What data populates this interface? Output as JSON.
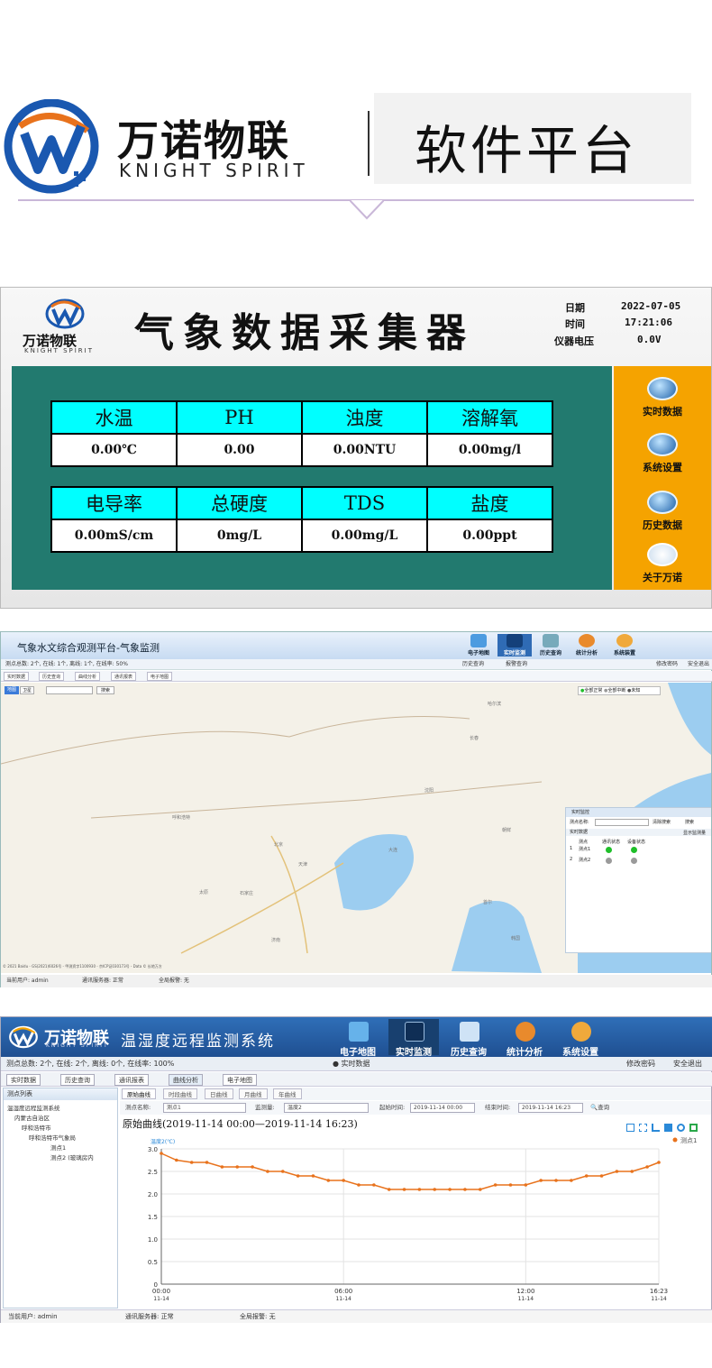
{
  "banner": {
    "brand_cn": "万诺物联",
    "brand_en": "KNIGHT SPIRIT",
    "title": "软件平台",
    "logo_icon": "wn-logo-icon"
  },
  "panel1": {
    "logo_cn": "万诺物联",
    "logo_en": "KNIGHT SPIRIT",
    "title": "气象数据采集器",
    "date_label": "日期",
    "date_value": "2022-07-05",
    "time_label": "时间",
    "time_value": "17:21:06",
    "voltage_label": "仪器电压",
    "voltage_value": "0.0V",
    "row1_headers": [
      "水温",
      "PH",
      "浊度",
      "溶解氧"
    ],
    "row1_values": [
      "0.00℃",
      "0.00",
      "0.00NTU",
      "0.00mg/l"
    ],
    "row2_headers": [
      "电导率",
      "总硬度",
      "TDS",
      "盐度"
    ],
    "row2_values": [
      "0.00mS/cm",
      "0mg/L",
      "0.00mg/L",
      "0.00ppt"
    ],
    "side_buttons": [
      {
        "label": "实时数据",
        "icon": "search-icon"
      },
      {
        "label": "系统设置",
        "icon": "settings-icon"
      },
      {
        "label": "历史数据",
        "icon": "save-icon"
      },
      {
        "label": "关于万诺",
        "icon": "wn-logo-icon"
      }
    ],
    "colors": {
      "teal": "#227a6f",
      "cyan": "#00ffff",
      "orange": "#f5a300"
    }
  },
  "panel2": {
    "title": "气象水文综合观测平台-气象监测",
    "toolbar": [
      "电子地图",
      "实时监测",
      "历史查询",
      "统计分析",
      "系统装置"
    ],
    "links": [
      "历史查询",
      "报警查询"
    ],
    "right_links": [
      "修改密码",
      "安全退出"
    ],
    "summary": "测点总数: 2个, 在线: 1个, 离线: 1个, 在线率: 50%",
    "tabs": [
      "实时数据",
      "历史查询",
      "曲线分析",
      "通讯报表",
      "电子地图"
    ],
    "map_types": [
      "地图",
      "卫星"
    ],
    "search_btn": "搜索",
    "legend": [
      "全部正常",
      "全部中断",
      "未知"
    ],
    "map_labels": [
      "北京",
      "天津",
      "沈阳",
      "大连",
      "朝鲜",
      "韩国",
      "首尔",
      "呼和浩特",
      "太原",
      "石家庄",
      "济南",
      "长春",
      "哈尔滨"
    ],
    "map_copyright": "© 2021 Baidu - GS(2021)6026号 - 甲测资字1100930 - 京ICP证030173号 - Data © 长地万方",
    "panel_title": "实时监控",
    "panel_search_label": "测点名称:",
    "panel_btns": [
      "清除搜索",
      "搜索"
    ],
    "panel_sub": "实时数据",
    "panel_show": "显示监测量",
    "panel_cols": [
      "测点",
      "通讯状态",
      "设备状态"
    ],
    "panel_rows": [
      {
        "idx": "1",
        "name": "测点1",
        "comm": "#1fbf2a",
        "dev": "#1fbf2a"
      },
      {
        "idx": "2",
        "name": "测点2",
        "comm": "#9a9a9a",
        "dev": "#9a9a9a"
      }
    ],
    "status_user": "当前用户: admin",
    "status_server": "通讯服务器: 正常",
    "status_alarm": "全局报警: 无"
  },
  "panel3": {
    "brand_cn": "万诺物联",
    "brand_en": "KNIGHT SPIRIT",
    "system_title": "温湿度远程监测系统",
    "toolbar": [
      "电子地图",
      "实时监测",
      "历史查询",
      "统计分析",
      "系统设置"
    ],
    "summary": "测点总数: 2个, 在线: 2个, 离线: 0个, 在线率: 100%",
    "realtime_label": "实时数据",
    "right_links": [
      "修改密码",
      "安全退出"
    ],
    "tabs": [
      "实时数据",
      "历史查询",
      "通讯报表",
      "曲线分析",
      "电子地图"
    ],
    "tree_title": "测点列表",
    "tree_nodes": [
      "温湿度远程监测系统",
      "内蒙古自治区",
      "呼和浩特市",
      "呼和浩特市气象局",
      "测点1",
      "测点2 (玻璃房内"
    ],
    "subtabs": [
      "原始曲线",
      "时段曲线",
      "日曲线",
      "月曲线",
      "年曲线"
    ],
    "filter": {
      "point_label": "测点名称:",
      "point_value": "测点1",
      "metric_label": "监测量:",
      "metric_value": "温度2",
      "start_label": "起始时间:",
      "start_value": "2019-11-14 00:00",
      "end_label": "结束时间:",
      "end_value": "2019-11-14 16:23",
      "query": "查询"
    },
    "chart_title": "原始曲线(2019-11-14 00:00—2019-11-14 16:23)",
    "status_user": "当前用户: admin",
    "status_server": "通讯服务器: 正常",
    "status_alarm": "全局报警: 无"
  },
  "chart_data": {
    "type": "line",
    "title": "原始曲线(2019-11-14 00:00—2019-11-14 16:23)",
    "ylabel": "温度2(℃)",
    "ylim": [
      0,
      3.0
    ],
    "yticks": [
      "0",
      "0.5",
      "1.0",
      "1.5",
      "2.0",
      "2.5",
      "3.0"
    ],
    "xticks": [
      [
        "00:00",
        "11-14"
      ],
      [
        "06:00",
        "11-14"
      ],
      [
        "12:00",
        "11-14"
      ],
      [
        "16:23",
        "11-14"
      ]
    ],
    "xlim_minutes": [
      0,
      983
    ],
    "series": [
      {
        "name": "测点1",
        "color": "#e8721c",
        "x": [
          0,
          30,
          60,
          90,
          120,
          150,
          180,
          210,
          240,
          270,
          300,
          330,
          360,
          390,
          420,
          450,
          480,
          510,
          540,
          570,
          600,
          630,
          660,
          690,
          720,
          750,
          780,
          810,
          840,
          870,
          900,
          930,
          960,
          983
        ],
        "values": [
          2.9,
          2.75,
          2.7,
          2.7,
          2.6,
          2.6,
          2.6,
          2.5,
          2.5,
          2.4,
          2.4,
          2.3,
          2.3,
          2.2,
          2.2,
          2.1,
          2.1,
          2.1,
          2.1,
          2.1,
          2.1,
          2.1,
          2.2,
          2.2,
          2.2,
          2.3,
          2.3,
          2.3,
          2.4,
          2.4,
          2.5,
          2.5,
          2.6,
          2.7
        ]
      }
    ],
    "grid": true,
    "legend": "top-right"
  }
}
